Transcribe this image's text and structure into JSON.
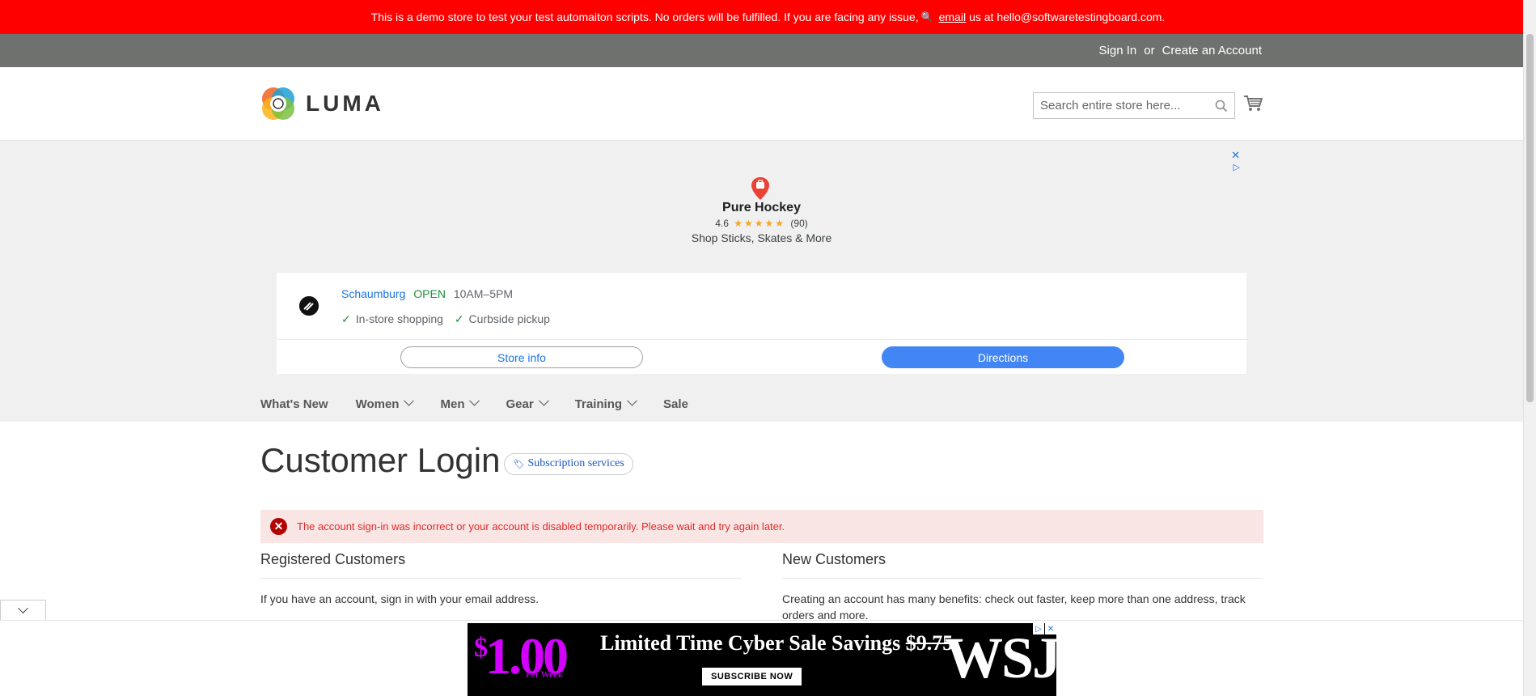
{
  "demo_bar": {
    "text_before": "This is a demo store to test your test automaiton scripts. No orders will be fulfilled. If you are facing any issue,",
    "key_glyph": "🔍",
    "link": "email",
    "text_after": "us at hello@softwaretestingboard.com."
  },
  "panel": {
    "sign_in": "Sign In",
    "or": "or",
    "create_account": "Create an Account"
  },
  "header": {
    "logo_text": "LUMA",
    "search_placeholder": "Search entire store here..."
  },
  "ad": {
    "close_glyph": "✕",
    "play_glyph": "▷",
    "business": "Pure Hockey",
    "rating_value": "4.6",
    "stars": "★★★★★",
    "rating_count": "(90)",
    "tagline": "Shop Sticks, Skates & More",
    "city": "Schaumburg",
    "status": "OPEN",
    "hours": "10AM–5PM",
    "feature_1": "In-store shopping",
    "feature_2": "Curbside pickup",
    "store_info": "Store info",
    "directions": "Directions"
  },
  "nav": {
    "items": [
      {
        "label": "What's New",
        "dropdown": false
      },
      {
        "label": "Women",
        "dropdown": true
      },
      {
        "label": "Men",
        "dropdown": true
      },
      {
        "label": "Gear",
        "dropdown": true
      },
      {
        "label": "Training",
        "dropdown": true
      },
      {
        "label": "Sale",
        "dropdown": false
      }
    ]
  },
  "main": {
    "title": "Customer Login",
    "subscription_badge": "Subscription services",
    "error_icon": "✕",
    "error": "The account sign-in was incorrect or your account is disabled temporarily. Please wait and try again later.",
    "registered_title": "Registered Customers",
    "registered_text": "If you have an account, sign in with your email address.",
    "new_title": "New Customers",
    "new_text": "Creating an account has many benefits: check out faster, keep more than one address, track orders and more."
  },
  "wsj_ad": {
    "dollar": "$",
    "price": "1.00",
    "per": "Per Week",
    "headline": "Limited Time Cyber Sale Savings",
    "old_price": "$9.75",
    "cta": "SUBSCRIBE NOW",
    "logo": "WSJ"
  },
  "colors": {
    "demo_bar": "#ff0000",
    "panel_bar": "#6e716e",
    "error_bg": "#fae5e5",
    "error_text": "#e02b27",
    "directions_button": "#4285f4"
  }
}
